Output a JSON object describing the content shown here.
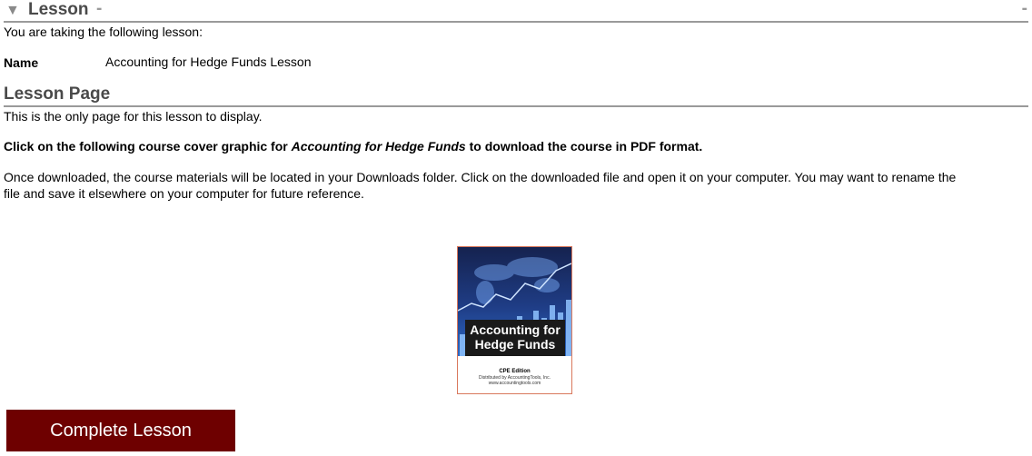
{
  "lesson_section": {
    "title": "Lesson",
    "collapse_icon": "triangle-down-icon",
    "intro": "You are taking the following lesson:",
    "name_label": "Name",
    "name_value": "Accounting for Hedge Funds Lesson"
  },
  "page_section": {
    "title": "Lesson Page",
    "only_page_text": "This is the only page for this lesson to display.",
    "instruction_prefix": "Click on the following course cover graphic for ",
    "instruction_italic": "Accounting for Hedge Funds",
    "instruction_suffix": " to download the course in PDF format.",
    "download_note_line1": "Once downloaded, the course materials will be located in your Downloads folder. Click on the downloaded file and open it on your computer. You may want to rename the",
    "download_note_line2": "file and save it elsewhere on your computer for future reference."
  },
  "cover": {
    "title_line1": "Accounting for",
    "title_line2": "Hedge Funds",
    "edition": "CPE Edition",
    "distributed": "Distributed by AccountingTools, Inc.",
    "url": "www.accountingtools.com"
  },
  "complete_button": {
    "label": "Complete Lesson",
    "color": "#6e0000"
  }
}
